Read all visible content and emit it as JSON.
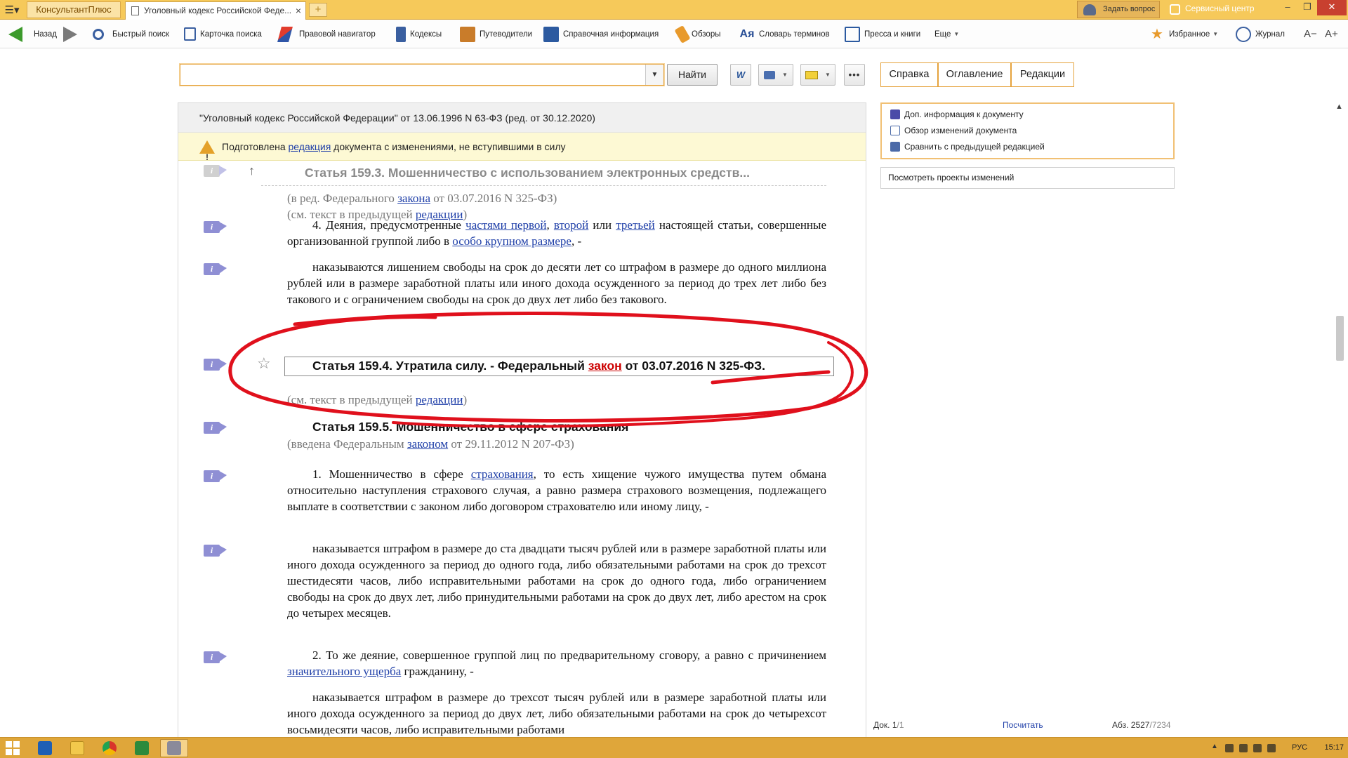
{
  "titlebar": {
    "app_name": "КонсультантПлюс",
    "tab_title": "Уголовный кодекс Российской Феде...",
    "new_tab": "+",
    "ask_question": "Задать вопрос",
    "service_center": "Сервисный центр"
  },
  "toolbar": {
    "back": "Назад",
    "quick_search": "Быстрый поиск",
    "search_card": "Карточка поиска",
    "legal_navigator": "Правовой навигатор",
    "codes": "Кодексы",
    "guides": "Путеводители",
    "reference_info": "Справочная информация",
    "reviews": "Обзоры",
    "dictionary": "Словарь терминов",
    "press": "Пресса и книги",
    "more": "Еще",
    "favorites": "Избранное",
    "journal": "Журнал",
    "font_smaller": "A−",
    "font_larger": "A+",
    "dictionary_glyph": "Ая"
  },
  "search": {
    "value": "",
    "find_button": "Найти",
    "word_glyph": "W",
    "more_glyph": "•••"
  },
  "right_tabs": [
    "Справка",
    "Оглавление",
    "Редакции"
  ],
  "doc": {
    "header": "\"Уголовный кодекс Российской Федерации\" от 13.06.1996 N 63-ФЗ (ред. от 30.12.2020)",
    "edition_prefix": "Подготовлена ",
    "edition_link": "редакция",
    "edition_suffix": " документа с изменениями, не вступившими в силу",
    "info_glyph": "i",
    "up_arrow": "↑",
    "star": "☆",
    "art1593_title": "Статья 159.3. Мошенничество с использованием электронных средств...",
    "art1593_note1_a": "(в ред. Федерального ",
    "art1593_note1_link": "закона",
    "art1593_note1_b": " от 03.07.2016 N 325-ФЗ)",
    "art1593_note2_a": "(см. текст в предыдущей ",
    "art1593_note2_link": "редакции",
    "art1593_note2_b": ")",
    "p4_a": "4. Деяния, предусмотренные ",
    "p4_link1": "частями первой",
    "p4_b": ", ",
    "p4_link2": "второй",
    "p4_c": " или ",
    "p4_link3": "третьей",
    "p4_d": "  настоящей статьи, совершенные организованной группой либо в ",
    "p4_link4": "особо крупном размере",
    "p4_e": ", -",
    "p4_punish": "наказываются лишением свободы на срок до десяти лет со штрафом в размере до одного миллиона рублей или в размере заработной платы или иного дохода осужденного за период до трех лет либо без такового и с ограничением свободы на срок до двух лет либо без такового.",
    "art1594_a": "Статья 159.4. Утратила силу. - Федеральный ",
    "art1594_link": "закон",
    "art1594_b": " от 03.07.2016 N 325-ФЗ.",
    "art1594_note_a": "(см. текст в предыдущей ",
    "art1594_note_link": "редакции",
    "art1594_note_b": ")",
    "art1595_title": "Статья 159.5. Мошенничество в сфере страхования",
    "art1595_note_a": "(введена Федеральным ",
    "art1595_note_link": "законом",
    "art1595_note_b": " от 29.11.2012 N 207-ФЗ)",
    "p1_a": "1. Мошенничество в сфере ",
    "p1_link": "страхования",
    "p1_b": ", то есть хищение чужого имущества путем обмана относительно наступления страхового случая, а равно размера страхового возмещения, подлежащего выплате в соответствии с законом либо договором страхователю или иному лицу, -",
    "p1_punish": "наказывается штрафом в размере до ста двадцати тысяч рублей или в размере заработной платы или иного дохода осужденного за период до одного года, либо обязательными работами на срок до трехсот шестидесяти часов, либо исправительными работами на срок до одного года, либо ограничением свободы на срок до двух лет, либо принудительными работами на срок до двух лет, либо арестом на срок до четырех месяцев.",
    "p2_a": "2. То же деяние, совершенное группой лиц по предварительному сговору, а равно с причинением ",
    "p2_link": "значительного ущерба",
    "p2_b": " гражданину, -",
    "p2_punish": "наказывается штрафом в размере до трехсот тысяч рублей или в размере заработной платы или иного дохода осужденного за период до двух лет, либо обязательными работами на срок до четырехсот восьмидесяти часов, либо исправительными работами"
  },
  "right_panel": {
    "items": [
      "Доп. информация к документу",
      "Обзор изменений документа",
      "Сравнить с предыдущей редакцией"
    ],
    "view_projects": "Посмотреть проекты изменений"
  },
  "status": {
    "doc_label": "Док. 1",
    "doc_total": "/1",
    "count_link": "Посчитать",
    "abs_label": "Абз. 2527",
    "abs_total": "/7234"
  },
  "taskbar": {
    "lang": "РУС",
    "time": "15:17"
  },
  "colors": {
    "titlebar": "#f6c95a",
    "link": "#1f3fa8",
    "annotation": "#e0101c",
    "edition_bar": "#fdf9d4"
  }
}
